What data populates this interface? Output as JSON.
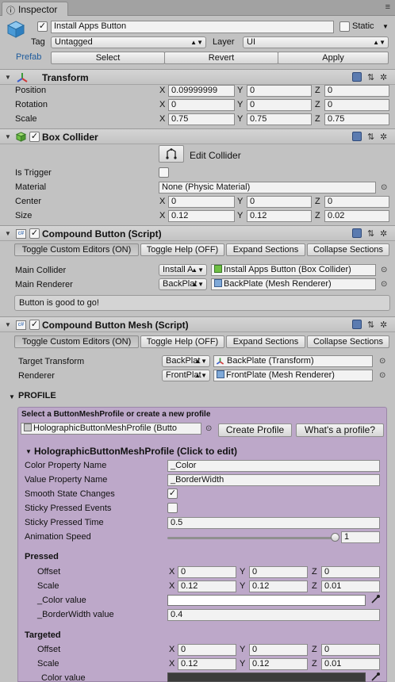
{
  "tab": {
    "title": "Inspector"
  },
  "object": {
    "name": "Install Apps Button",
    "static_label": "Static",
    "tag_label": "Tag",
    "tag_value": "Untagged",
    "layer_label": "Layer",
    "layer_value": "UI",
    "prefab_label": "Prefab",
    "select_label": "Select",
    "revert_label": "Revert",
    "apply_label": "Apply"
  },
  "transform": {
    "title": "Transform",
    "position_label": "Position",
    "rotation_label": "Rotation",
    "scale_label": "Scale",
    "position": {
      "x": "0.09999999",
      "y": "0",
      "z": "0"
    },
    "rotation": {
      "x": "0",
      "y": "0",
      "z": "0"
    },
    "scale": {
      "x": "0.75",
      "y": "0.75",
      "z": "0.75"
    }
  },
  "axes": {
    "x": "X",
    "y": "Y",
    "z": "Z"
  },
  "box_collider": {
    "title": "Box Collider",
    "edit_label": "Edit Collider",
    "is_trigger_label": "Is Trigger",
    "material_label": "Material",
    "material_value": "None (Physic Material)",
    "center_label": "Center",
    "size_label": "Size",
    "center": {
      "x": "0",
      "y": "0",
      "z": "0"
    },
    "size": {
      "x": "0.12",
      "y": "0.12",
      "z": "0.02"
    }
  },
  "compound_button": {
    "title": "Compound Button (Script)",
    "toggle_custom": "Toggle Custom Editors (ON)",
    "toggle_help": "Toggle Help (OFF)",
    "expand": "Expand Sections",
    "collapse": "Collapse Sections",
    "main_collider_label": "Main Collider",
    "main_collider_drop": "Install A",
    "main_collider_value": "Install Apps Button (Box Collider)",
    "main_renderer_label": "Main Renderer",
    "main_renderer_drop": "BackPlat",
    "main_renderer_value": "BackPlate (Mesh Renderer)",
    "status": "Button is good to go!"
  },
  "compound_mesh": {
    "title": "Compound Button Mesh (Script)",
    "toggle_custom": "Toggle Custom Editors (ON)",
    "toggle_help": "Toggle Help (OFF)",
    "expand": "Expand Sections",
    "collapse": "Collapse Sections",
    "target_label": "Target Transform",
    "target_drop": "BackPlat",
    "target_value": "BackPlate (Transform)",
    "renderer_label": "Renderer",
    "renderer_drop": "FrontPlat",
    "renderer_value": "FrontPlate (Mesh Renderer)"
  },
  "profile": {
    "section": "PROFILE",
    "select_text": "Select a ButtonMeshProfile or create a new profile",
    "profile_value": "HolographicButtonMeshProfile (Butto",
    "create_label": "Create Profile",
    "whats_label": "What's a profile?",
    "holo_title": "HolographicButtonMeshProfile (Click to edit)",
    "color_prop_label": "Color Property Name",
    "color_prop_value": "_Color",
    "value_prop_label": "Value Property Name",
    "value_prop_value": "_BorderWidth",
    "smooth_label": "Smooth State Changes",
    "sticky_events_label": "Sticky Pressed Events",
    "sticky_time_label": "Sticky Pressed Time",
    "sticky_time_value": "0.5",
    "anim_label": "Animation Speed",
    "anim_value": "1",
    "anim_fraction": 1.0,
    "pressed_title": "Pressed",
    "offset_label": "Offset",
    "scale_label": "Scale",
    "color_value_label": "_Color value",
    "border_value_label": "_BorderWidth value",
    "pressed_offset": {
      "x": "0",
      "y": "0",
      "z": "0"
    },
    "pressed_scale": {
      "x": "0.12",
      "y": "0.12",
      "z": "0.01"
    },
    "pressed_border": "0.4",
    "pressed_color": "#ffffff",
    "targeted_title": "Targeted",
    "targeted_offset": {
      "x": "0",
      "y": "0",
      "z": "0"
    },
    "targeted_scale": {
      "x": "0.12",
      "y": "0.12",
      "z": "0.01"
    },
    "targeted_color_label": "Color value",
    "targeted_color": "#3c3c3c"
  },
  "colors": {
    "panel_bg": "#c2c2c2",
    "profile_bg": "#bda8c9",
    "header_bg": "#cbcbcb"
  }
}
